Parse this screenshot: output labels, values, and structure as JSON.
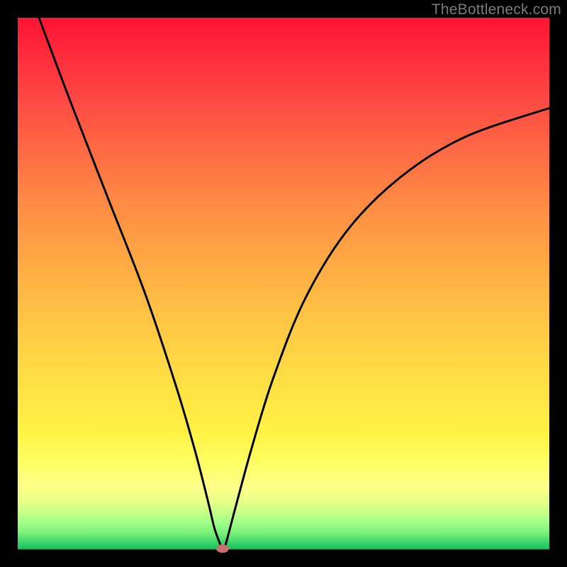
{
  "watermark": {
    "text": "TheBottleneck.com"
  },
  "chart_data": {
    "type": "line",
    "title": "",
    "xlabel": "",
    "ylabel": "",
    "xlim": [
      0,
      100
    ],
    "ylim": [
      0,
      100
    ],
    "series": [
      {
        "name": "bottleneck-curve",
        "x": [
          4,
          10,
          17,
          24,
          30,
          33.5,
          35.8,
          37,
          38,
          38.5,
          38.8,
          39.2,
          41,
          44,
          48,
          54,
          62,
          72,
          84,
          100
        ],
        "y": [
          100,
          84,
          66,
          48,
          30,
          18,
          9,
          4,
          1.2,
          0.2,
          0.3,
          1.2,
          8,
          19,
          32,
          47,
          60,
          70,
          77.5,
          83
        ]
      }
    ],
    "annotations": [
      {
        "name": "minimum-marker",
        "x": 38.5,
        "y": 0.2
      }
    ],
    "background": {
      "type": "vertical-gradient",
      "stops": [
        {
          "pos": 0,
          "color": "#ff1434"
        },
        {
          "pos": 50,
          "color": "#ffb044"
        },
        {
          "pos": 85,
          "color": "#ffff70"
        },
        {
          "pos": 100,
          "color": "#10c060"
        }
      ]
    }
  }
}
